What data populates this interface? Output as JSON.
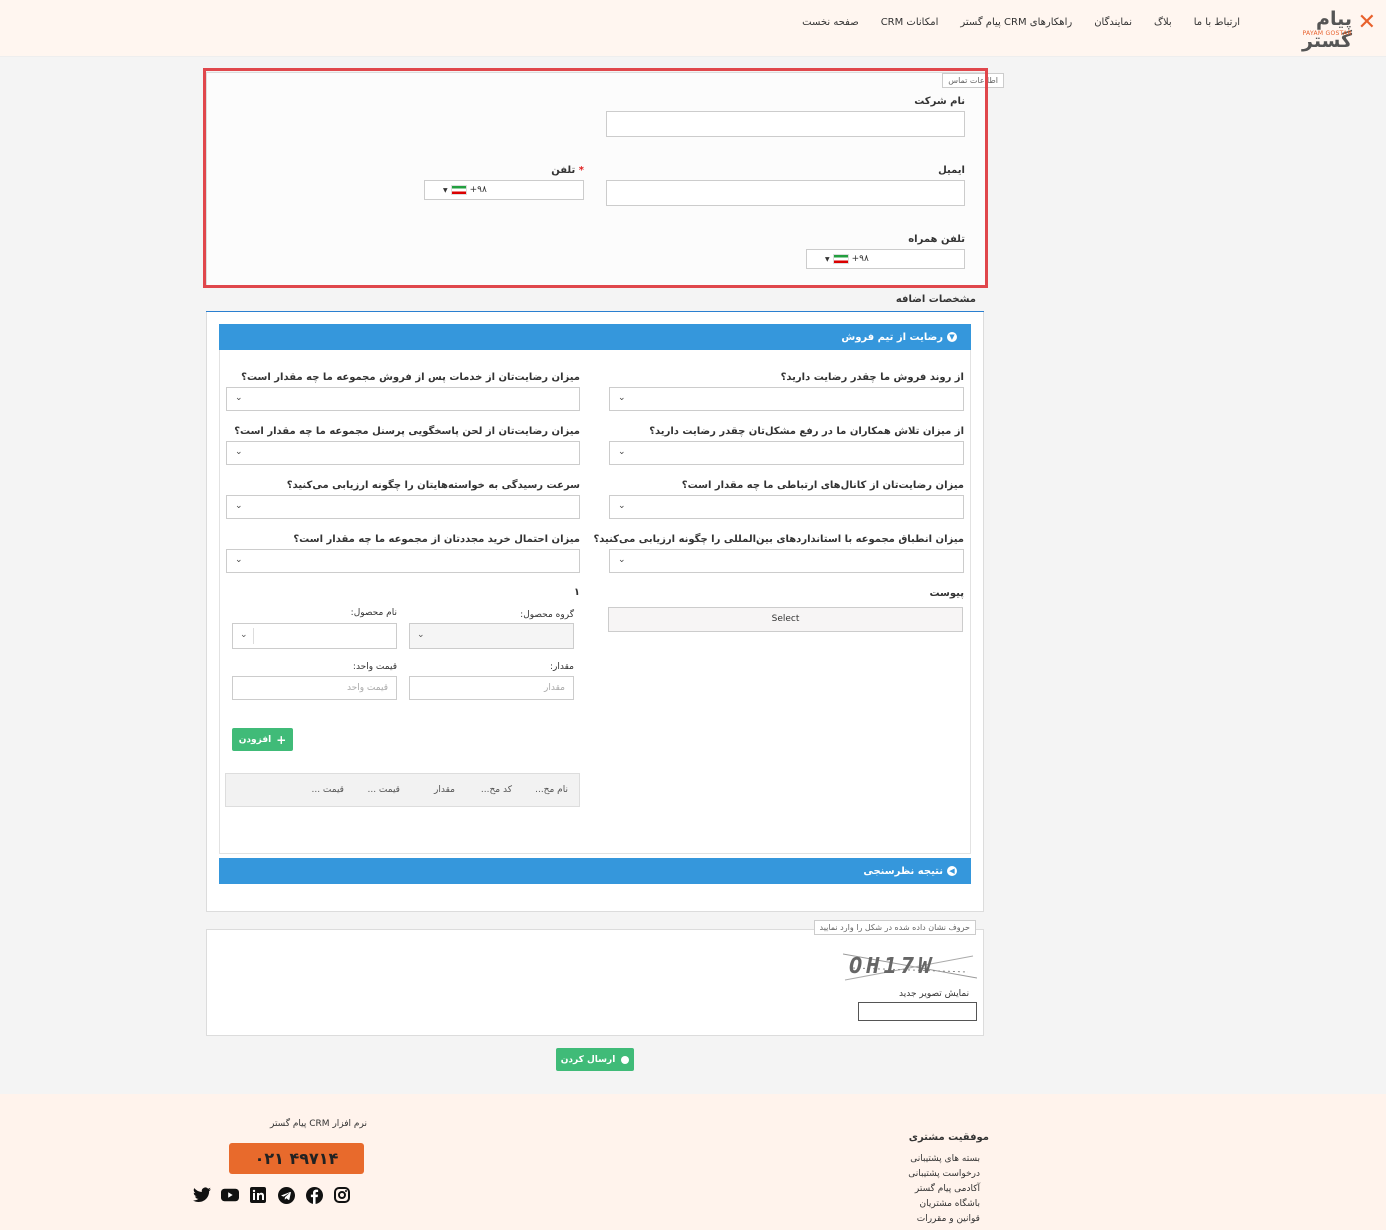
{
  "header": {
    "logo_text": "پیام گستر",
    "logo_sub": "PAYAM GOSTAR",
    "nav": [
      "صفحه نخست",
      "امکانات CRM",
      "راهکارهای CRM پیام گستر",
      "نمایندگان",
      "بلاگ",
      "ارتباط با ما"
    ]
  },
  "contact": {
    "legend": "اطلاعات تماس",
    "company_label": "نام شرکت",
    "email_label": "ایمیل",
    "phone_label": "تلفن",
    "phone_required": "*",
    "phone_code": "+۹۸",
    "mobile_label": "تلفن همراه",
    "mobile_code": "+۹۸"
  },
  "extra": {
    "tab_label": "مشخصات اضافه",
    "panel1_title": "رضایت از تیم فروش",
    "panel2_title": "نتیجه نظرسنجی",
    "questions": {
      "q1": "از روند فروش ما چقدر رضایت دارید؟",
      "q2": "میزان رضایت‌تان از خدمات پس از فروش مجموعه ما چه مقدار است؟",
      "q3": "از میزان تلاش همکاران ما در رفع مشکل‌تان چقدر رضایت دارید؟",
      "q4": "میزان رضایت‌تان از لحن پاسخگویی پرسنل مجموعه ما چه مقدار است؟",
      "q5": "میزان رضایت‌تان از کانال‌های ارتباطی ما چه مقدار است؟",
      "q6": "سرعت رسیدگی به خواسته‌هایتان را چگونه ارزیابی می‌کنید؟",
      "q7": "میزان انطباق مجموعه با استانداردهای بین‌المللی را چگونه ارزیابی می‌کنید؟",
      "q8": "میزان احتمال خرید مجددتان از مجموعه ما چه مقدار است؟"
    },
    "attachment_label": "پیوست",
    "select_button": "Select",
    "product_index": "۱",
    "product_group_label": "گروه محصول:",
    "product_name_label": "نام محصول:",
    "quantity_label": "مقدار:",
    "quantity_placeholder": "مقدار",
    "unit_price_label": "قیمت واحد:",
    "unit_price_placeholder": "قیمت واحد",
    "add_button": "افزودن",
    "table_headers": [
      "نام مح...",
      "کد مح...",
      "مقدار",
      "قیمت ...",
      "قیمت ..."
    ]
  },
  "captcha": {
    "legend": "حروف نشان داده شده در شکل را وارد نمایید",
    "image_text": "OH17W",
    "new_image": "نمایش تصویر جدید"
  },
  "submit_button": "ارسال کردن",
  "footer": {
    "section_title": "موفقیت مشتری",
    "links": [
      "بسته های پشتیبانی",
      "درخواست پشتیبانی",
      "آکادمی پیام گستر",
      "باشگاه مشتریان",
      "قوانین و مقررات"
    ],
    "crm_text": "نرم افزار CRM پیام گستر",
    "phone": "۰۲۱ ۴۹۷۱۴",
    "social_icons": [
      "instagram-icon",
      "facebook-icon",
      "telegram-icon",
      "linkedin-icon",
      "youtube-icon",
      "twitter-icon"
    ]
  },
  "colors": {
    "brand_orange": "#e86a2c",
    "panel_blue": "#3597dc",
    "button_green": "#40bb78",
    "highlight_red": "#e0474c"
  }
}
